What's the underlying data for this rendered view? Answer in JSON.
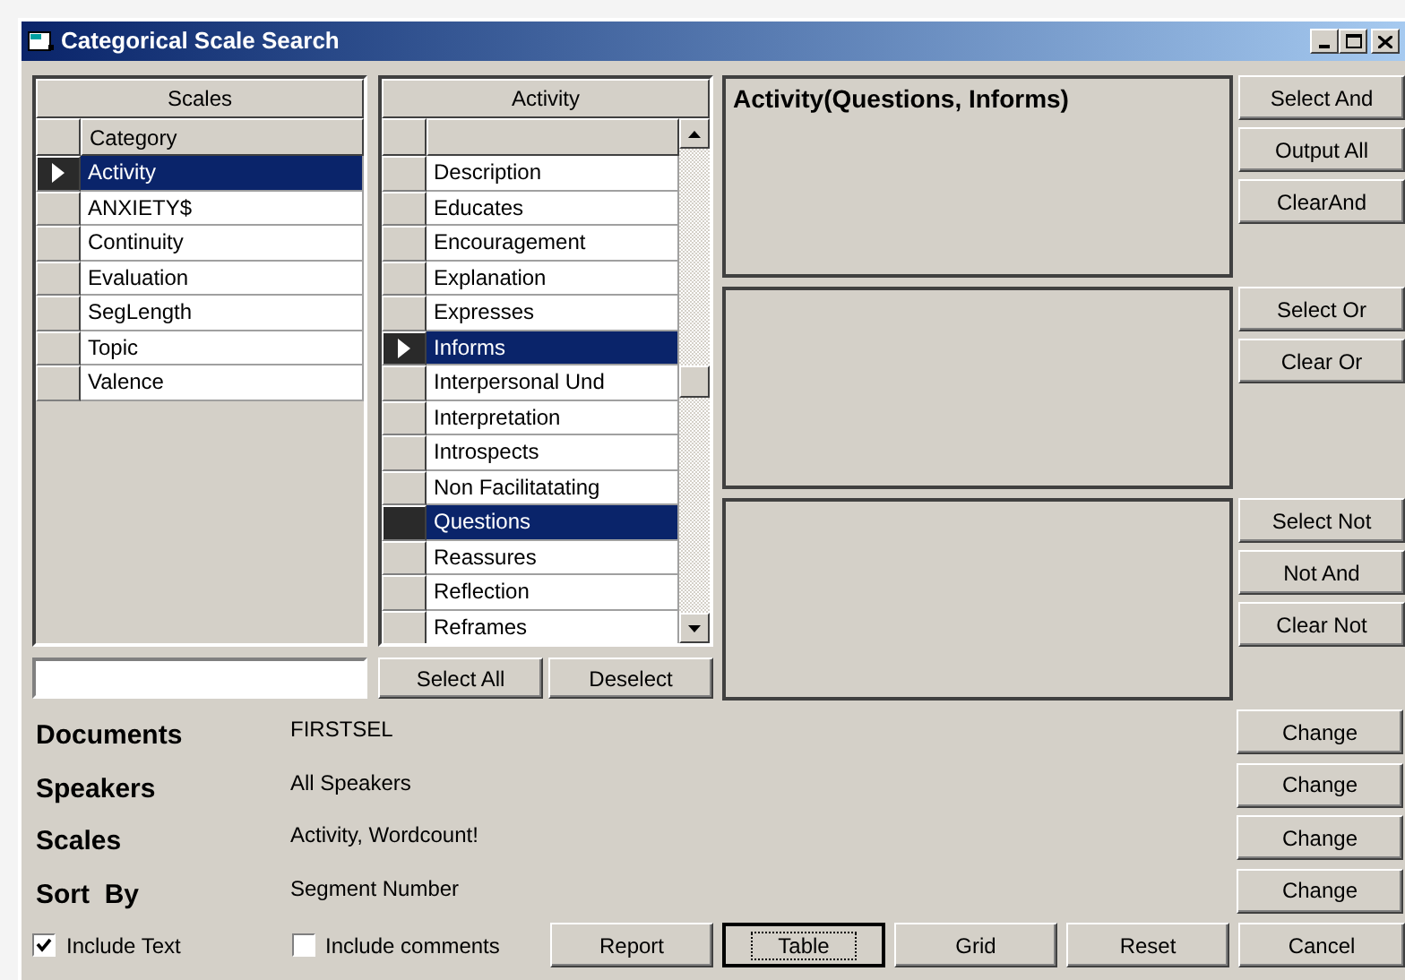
{
  "window": {
    "title": "Categorical Scale Search"
  },
  "scales_grid": {
    "header": "Scales",
    "column": "Category",
    "rows": [
      {
        "label": "Activity",
        "selected": true,
        "current": true
      },
      {
        "label": "ANXIETY$",
        "selected": false,
        "current": false
      },
      {
        "label": "Continuity",
        "selected": false,
        "current": false
      },
      {
        "label": "Evaluation",
        "selected": false,
        "current": false
      },
      {
        "label": "SegLength",
        "selected": false,
        "current": false
      },
      {
        "label": "Topic",
        "selected": false,
        "current": false
      },
      {
        "label": "Valence",
        "selected": false,
        "current": false
      }
    ]
  },
  "activity_grid": {
    "header": "Activity",
    "rows": [
      {
        "label": "Description",
        "selected": false,
        "current": false
      },
      {
        "label": "Educates",
        "selected": false,
        "current": false
      },
      {
        "label": "Encouragement",
        "selected": false,
        "current": false
      },
      {
        "label": "Explanation",
        "selected": false,
        "current": false
      },
      {
        "label": "Expresses",
        "selected": false,
        "current": false
      },
      {
        "label": "Informs",
        "selected": true,
        "current": true
      },
      {
        "label": "Interpersonal Und",
        "selected": false,
        "current": false
      },
      {
        "label": "Interpretation",
        "selected": false,
        "current": false
      },
      {
        "label": "Introspects",
        "selected": false,
        "current": false
      },
      {
        "label": "Non Facilitatating",
        "selected": false,
        "current": false
      },
      {
        "label": "Questions",
        "selected": true,
        "current": false
      },
      {
        "label": "Reassures",
        "selected": false,
        "current": false
      },
      {
        "label": "Reflection",
        "selected": false,
        "current": false
      },
      {
        "label": "Reframes",
        "selected": false,
        "current": false
      }
    ]
  },
  "list_buttons": [
    "Select All",
    "Deselect"
  ],
  "query_panels": [
    {
      "text": "Activity(Questions, Informs)",
      "buttons": [
        "Select And",
        "Output All",
        "ClearAnd"
      ]
    },
    {
      "buttons": [
        "Select Or",
        "Clear Or"
      ]
    },
    {
      "buttons": [
        "Select Not",
        "Not And",
        "Clear Not"
      ]
    }
  ],
  "settings": [
    {
      "label": "Documents",
      "value": "FIRSTSEL",
      "button": "Change"
    },
    {
      "label": "Speakers",
      "value": "All Speakers",
      "button": "Change"
    },
    {
      "label": "Scales",
      "value": "Activity, Wordcount!",
      "button": "Change"
    },
    {
      "label": "Sort  By",
      "value": "Segment Number",
      "button": "Change"
    }
  ],
  "options": [
    {
      "label": "Include Text",
      "checked": true
    },
    {
      "label": "Include comments",
      "checked": false
    }
  ],
  "actions": [
    {
      "label": "Report",
      "focused": false
    },
    {
      "label": "Table",
      "focused": true
    },
    {
      "label": "Grid",
      "focused": false
    },
    {
      "label": "Reset",
      "focused": false
    },
    {
      "label": "Cancel",
      "focused": false
    }
  ]
}
